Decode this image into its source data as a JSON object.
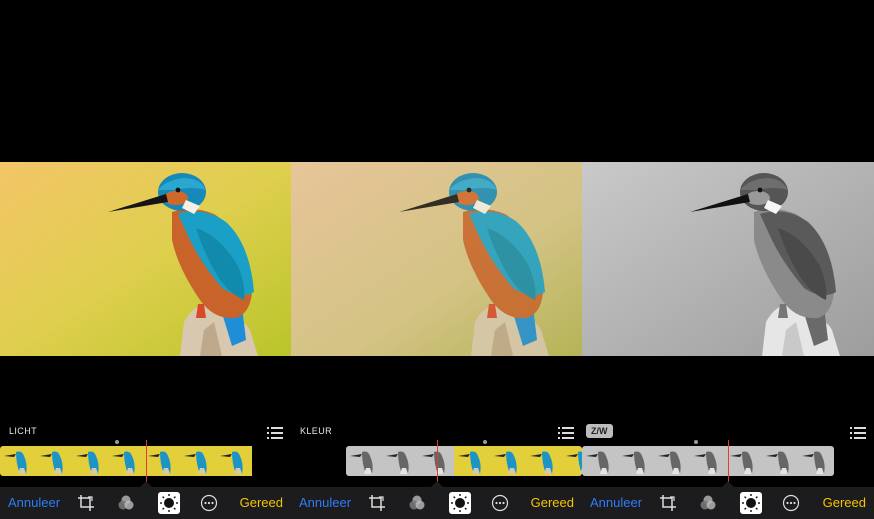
{
  "panels": [
    {
      "section": "LICHT",
      "mode": "color-vivid",
      "toolbar": {
        "cancel_label": "Annuleer",
        "done_label": "Gereed"
      },
      "icons": [
        "crop-icon",
        "filters-icon",
        "adjust-icon",
        "more-icon",
        "list-icon"
      ]
    },
    {
      "section": "KLEUR",
      "mode": "color-muted",
      "toolbar": {
        "cancel_label": "Annuleer",
        "done_label": "Gereed"
      },
      "icons": [
        "crop-icon",
        "filters-icon",
        "adjust-icon",
        "more-icon",
        "list-icon"
      ]
    },
    {
      "section": "Z/W",
      "mode": "black-and-white",
      "toolbar": {
        "cancel_label": "Annuleer",
        "done_label": "Gereed"
      },
      "icons": [
        "crop-icon",
        "filters-icon",
        "adjust-icon",
        "more-icon",
        "list-icon"
      ]
    }
  ],
  "colors": {
    "cancel": "#2f7cf6",
    "done": "#f5c400",
    "toolbar_bg": "#1c1c1e",
    "indicator": "#e53935"
  }
}
